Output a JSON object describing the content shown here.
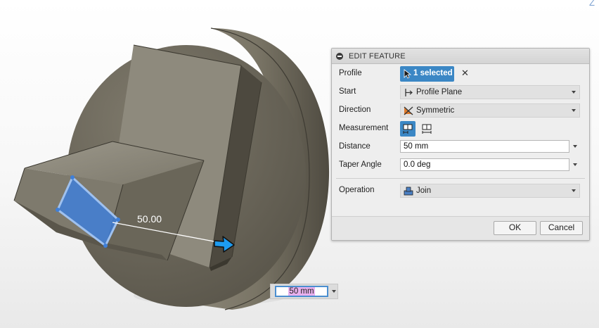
{
  "viewport": {
    "axis_label": "Z",
    "dimension_label": "50.00",
    "distance_input": "50 mm"
  },
  "dialog": {
    "title": "EDIT FEATURE",
    "rows": {
      "profile": {
        "label": "Profile",
        "value": "1 selected"
      },
      "start": {
        "label": "Start",
        "value": "Profile Plane",
        "icon": "profile-plane-icon"
      },
      "direction": {
        "label": "Direction",
        "value": "Symmetric",
        "icon": "symmetric-icon"
      },
      "measurement": {
        "label": "Measurement",
        "options": [
          "half-length-icon",
          "whole-length-icon"
        ]
      },
      "distance": {
        "label": "Distance",
        "value": "50 mm"
      },
      "taper": {
        "label": "Taper Angle",
        "value": "0.0 deg"
      },
      "operation": {
        "label": "Operation",
        "value": "Join",
        "icon": "join-icon"
      }
    },
    "ok_label": "OK",
    "cancel_label": "Cancel"
  },
  "colors": {
    "accent": "#3b87c5",
    "model_body": "#6f6a5c",
    "selected_face": "#3f7fd8",
    "arrow": "#1d9bf0"
  }
}
